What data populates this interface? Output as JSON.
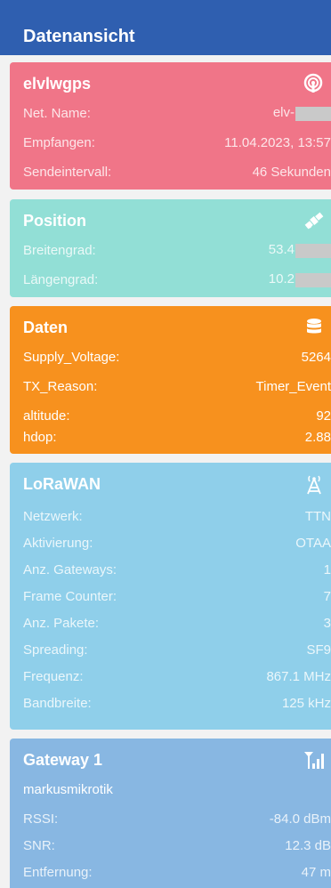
{
  "app": {
    "title": "Datenansicht"
  },
  "device": {
    "name": "elvlwgps",
    "rows": [
      {
        "label": "Net. Name:",
        "value": "elv-"
      },
      {
        "label": "Empfangen:",
        "value": "11.04.2023, 13:57"
      },
      {
        "label": "Sendeintervall:",
        "value": "46 Sekunden"
      }
    ],
    "icon": "signal-tower-icon",
    "color": "#f07588"
  },
  "position": {
    "title": "Position",
    "rows": [
      {
        "label": "Breitengrad:",
        "value": "53.4"
      },
      {
        "label": "Längengrad:",
        "value": "10.2"
      }
    ],
    "icon": "satellite-icon",
    "color": "#92dfd6"
  },
  "daten": {
    "title": "Daten",
    "rows": [
      {
        "label": "Supply_Voltage:",
        "value": "5264"
      },
      {
        "label": "TX_Reason:",
        "value": "Timer_Event"
      },
      {
        "label": "altitude:",
        "value": "92"
      },
      {
        "label": "hdop:",
        "value": "2.88"
      }
    ],
    "icon": "database-icon",
    "color": "#f7911e"
  },
  "lorawan": {
    "title": "LoRaWAN",
    "rows": [
      {
        "label": "Netzwerk:",
        "value": "TTN"
      },
      {
        "label": "Aktivierung:",
        "value": "OTAA"
      },
      {
        "label": "Anz. Gateways:",
        "value": "1"
      },
      {
        "label": "Frame Counter:",
        "value": "7"
      },
      {
        "label": "Anz. Pakete:",
        "value": "3"
      },
      {
        "label": "Spreading:",
        "value": "SF9"
      },
      {
        "label": "Frequenz:",
        "value": "867.1 MHz"
      },
      {
        "label": "Bandbreite:",
        "value": "125 kHz"
      }
    ],
    "icon": "antenna-icon",
    "color": "#8fcfea"
  },
  "gateway": {
    "title": "Gateway 1",
    "subtitle": "markusmikrotik",
    "rows": [
      {
        "label": "RSSI:",
        "value": "-84.0 dBm"
      },
      {
        "label": "SNR:",
        "value": "12.3 dB"
      },
      {
        "label": "Entfernung:",
        "value": "47 m"
      }
    ],
    "icon": "signal-bars-icon",
    "color": "#88b7e2"
  }
}
